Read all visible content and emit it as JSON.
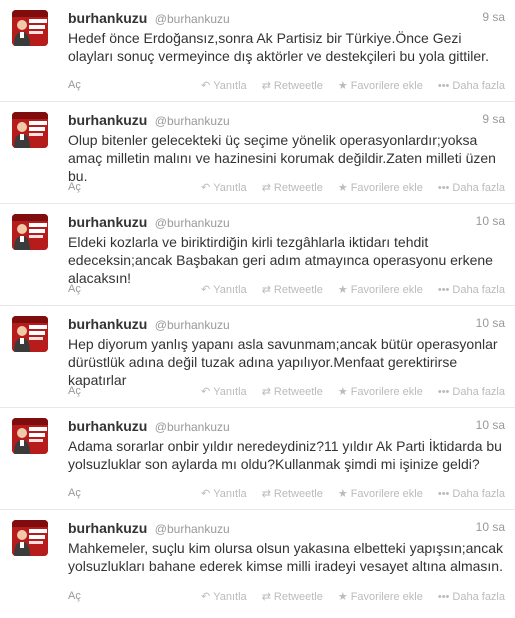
{
  "tweets": [
    {
      "fullname": "burhankuzu",
      "username": "@burhankuzu",
      "time": "9 sa",
      "text": "Hedef önce Erdoğansız,sonra Ak Partisiz bir Türkiye.Önce Gezi olayları sonuç vermeyince dış aktörler ve destekçileri bu yola gittiler."
    },
    {
      "fullname": "burhankuzu",
      "username": "@burhankuzu",
      "time": "9 sa",
      "text": "Olup bitenler gelecekteki üç seçime yönelik operasyonlardır;yoksa amaç milletin malını ve hazinesini korumak değildir.Zaten milleti üzen bu."
    },
    {
      "fullname": "burhankuzu",
      "username": "@burhankuzu",
      "time": "10 sa",
      "text": "Eldeki kozlarla ve biriktirdiğin kirli tezgâhlarla iktidarı tehdit edeceksin;ancak Başbakan geri adım atmayınca operasyonu erkene alacaksın!"
    },
    {
      "fullname": "burhankuzu",
      "username": "@burhankuzu",
      "time": "10 sa",
      "text": "Hep diyorum yanlış yapanı asla savunmam;ancak bütür operasyonlar dürüstlük adına değil tuzak adına yapılıyor.Menfaat gerektirirse kapatırlar"
    },
    {
      "fullname": "burhankuzu",
      "username": "@burhankuzu",
      "time": "10 sa",
      "text": "Adama sorarlar  onbir yıldır neredeydiniz?11 yıldır Ak Parti İktidarda bu yolsuzluklar son aylarda mı oldu?Kullanmak şimdi mi işinize geldi?"
    },
    {
      "fullname": "burhankuzu",
      "username": "@burhankuzu",
      "time": "10 sa",
      "text": "Mahkemeler, suçlu kim olursa olsun yakasına elbetteki yapışsın;ancak yolsuzlukları bahane ederek kimse milli iradeyi vesayet altına almasın."
    }
  ],
  "labels": {
    "expand": "Aç",
    "reply": "Yanıtla",
    "retweet": "Retweetle",
    "favorite": "Favorilere ekle",
    "more": "Daha fazla"
  },
  "icons": {
    "reply": "reply-icon",
    "retweet": "retweet-icon",
    "favorite": "star-icon",
    "more": "more-dots-icon"
  },
  "colors": {
    "avatar_bg": "#b71c1c",
    "text": "#333333",
    "muted": "#999999"
  }
}
